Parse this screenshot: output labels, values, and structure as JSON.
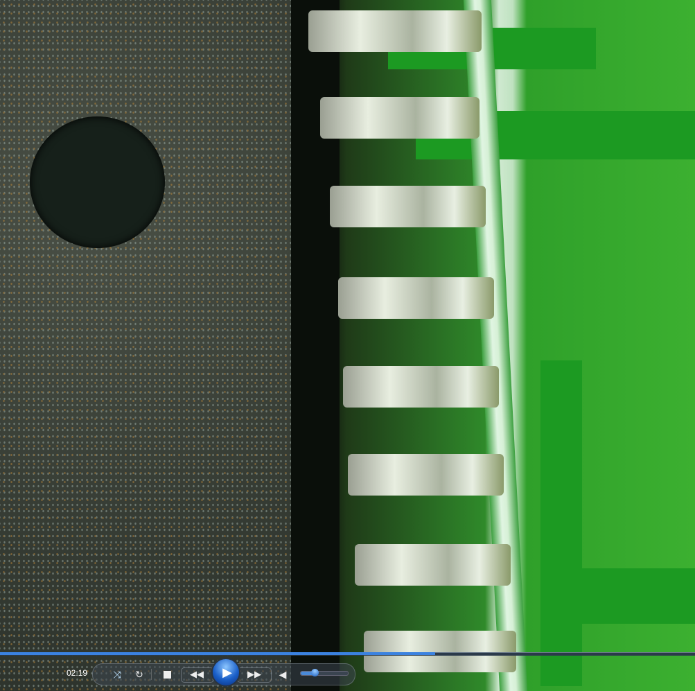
{
  "player": {
    "elapsed_time": "02:19",
    "seek_progress": 0.626,
    "volume": 0.3,
    "icons": [
      "shuffle-icon",
      "repeat-icon",
      "stop-icon",
      "previous-icon",
      "play-icon",
      "next-icon",
      "volume-icon"
    ],
    "accent_color": "#3b82e0"
  }
}
